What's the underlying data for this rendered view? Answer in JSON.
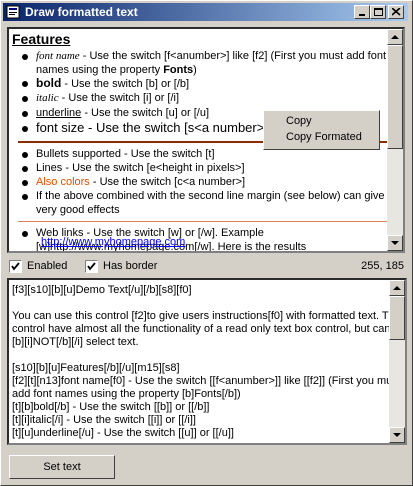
{
  "window": {
    "title": "Draw formatted text"
  },
  "preview": {
    "heading": "Features",
    "items": [
      {
        "p1": "font name",
        "p2": " - Use the switch [f<anumber>] like [f2] (First you must add font"
      },
      {
        "cont_a": "names using the property ",
        "cont_b": "Fonts",
        "cont_c": ")"
      },
      {
        "p1": "bold",
        "p2": " - Use the switch [b] or [/b]"
      },
      {
        "p1": "italic",
        "p2": " - Use the switch [i] or [/i]"
      },
      {
        "p1": "underline",
        "p2": " - Use the switch [u] or [/u]"
      },
      {
        "p1": "font size - Use the switch [s<a number>] like [s10]"
      },
      {
        "p1": "Bullets supported - Use the switch [t]"
      },
      {
        "p1": "Lines - Use the switch [e<height in pixels>]"
      },
      {
        "p1": "Also colors",
        "p2": " - Use the switch [c<a number>]"
      },
      {
        "p1": "If the above combined with the second line margin (see below) can give"
      },
      {
        "p1": "very good effects"
      },
      {
        "p1": "Web links - Use the switch [w] or [/w]. Example"
      },
      {
        "p1": "[w]http://www.myhomepage.com[/w]. Here is the results"
      },
      {
        "p1": "http://www.myhomepage.com"
      }
    ],
    "link_color": "#0000ff",
    "orange": "#e05000"
  },
  "context_menu": {
    "copy": "Copy",
    "copy_formated": "Copy Formated"
  },
  "options": {
    "enabled": "Enabled",
    "has_border": "Has border",
    "coords": "255, 185"
  },
  "source": {
    "lines": [
      "[f3][s10][b][u]Demo Text[/u][/b][s8][f0]",
      "",
      "You can use this control [f2]to give users instructions[f0] with formatted text. This",
      "control have almost all the functionality of a read only text box control, but can",
      "[b][i]NOT[/b][/i] select text.",
      "",
      "[s10][b][u]Features[/b][/u][m15][s8]",
      "[f2][t][n13]font name[f0] - Use the switch [[f<anumber>]] like [[f2]] (First you must",
      "add font names using the property [b]Fonts[/b])",
      "[t][b]bold[/b] - Use the switch [[b]] or [[/b]]",
      "[t][i]italic[/i] - Use the switch [[i]] or [[/i]]",
      "[t][u]underline[/u] - Use the switch [[u]] or [[/u]]"
    ]
  },
  "button": {
    "set_text": "Set text"
  }
}
